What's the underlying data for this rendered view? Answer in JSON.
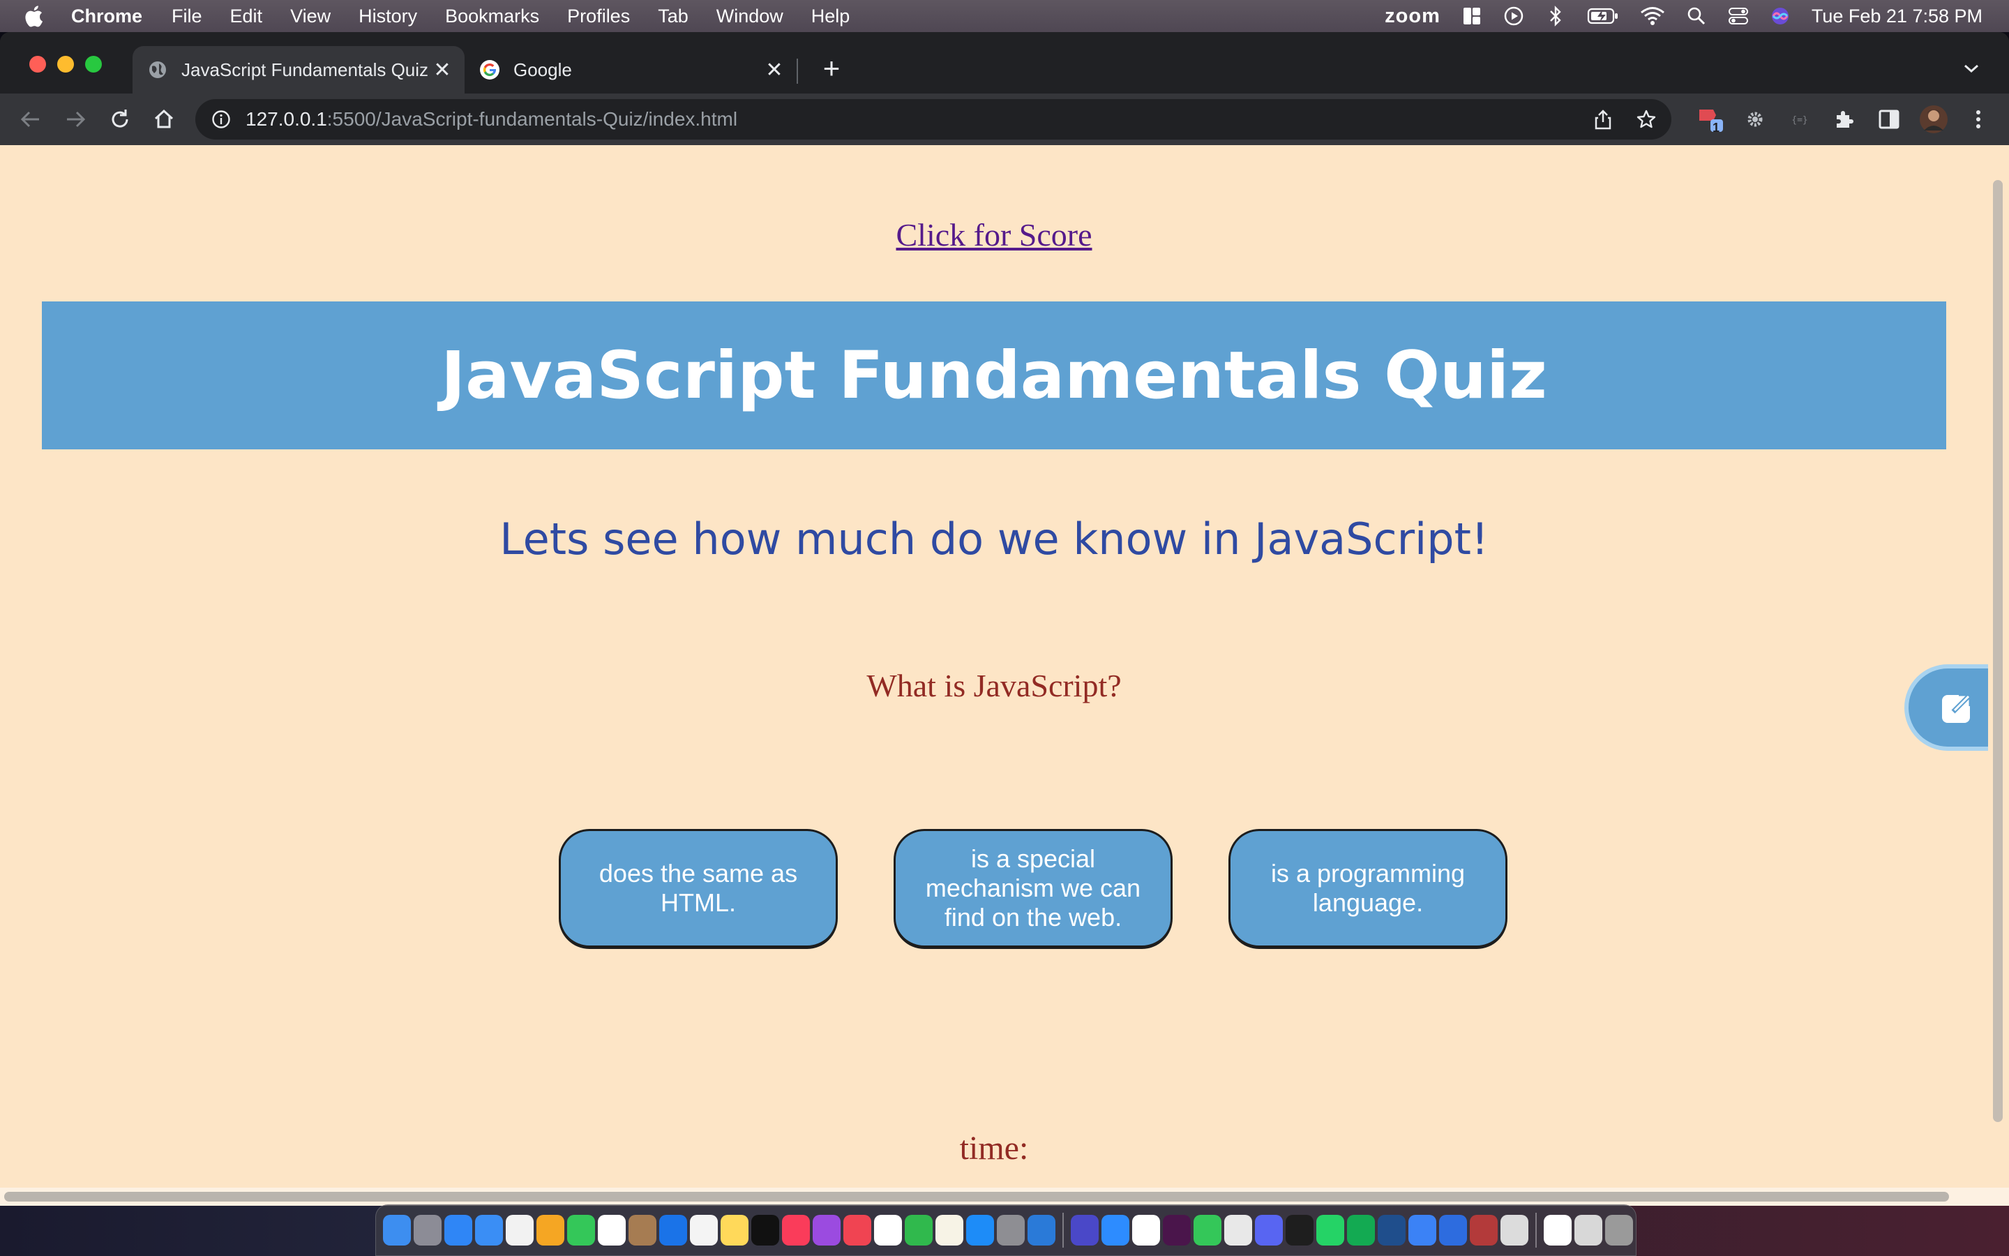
{
  "menubar": {
    "app_name": "Chrome",
    "items": [
      "File",
      "Edit",
      "View",
      "History",
      "Bookmarks",
      "Profiles",
      "Tab",
      "Window",
      "Help"
    ],
    "zoom_label": "zoom",
    "clock": "Tue Feb 21  7:58 PM"
  },
  "browser": {
    "tabs": [
      {
        "title": "JavaScript Fundamentals Quiz",
        "favicon": "globe-icon",
        "active": true
      },
      {
        "title": "Google",
        "favicon": "google-g-icon",
        "active": false
      }
    ],
    "url": {
      "host": "127.0.0.1",
      "path": ":5500/JavaScript-fundamentals-Quiz/index.html"
    },
    "extension_badge": "1"
  },
  "page": {
    "score_link": "Click for Score",
    "banner_title": "JavaScript Fundamentals Quiz",
    "intro": "Lets see how much do we know in JavaScript!",
    "question": "What is JavaScript?",
    "answers": [
      "does the same as HTML.",
      "is a special mechanism we can find on the web.",
      "is a programming language."
    ],
    "time_label": "time:"
  },
  "colors": {
    "page_background": "#fde5c6",
    "banner": "#5fa1d2",
    "intro_text": "#2f4aa2",
    "question_text": "#922b24",
    "link": "#551a8b"
  }
}
